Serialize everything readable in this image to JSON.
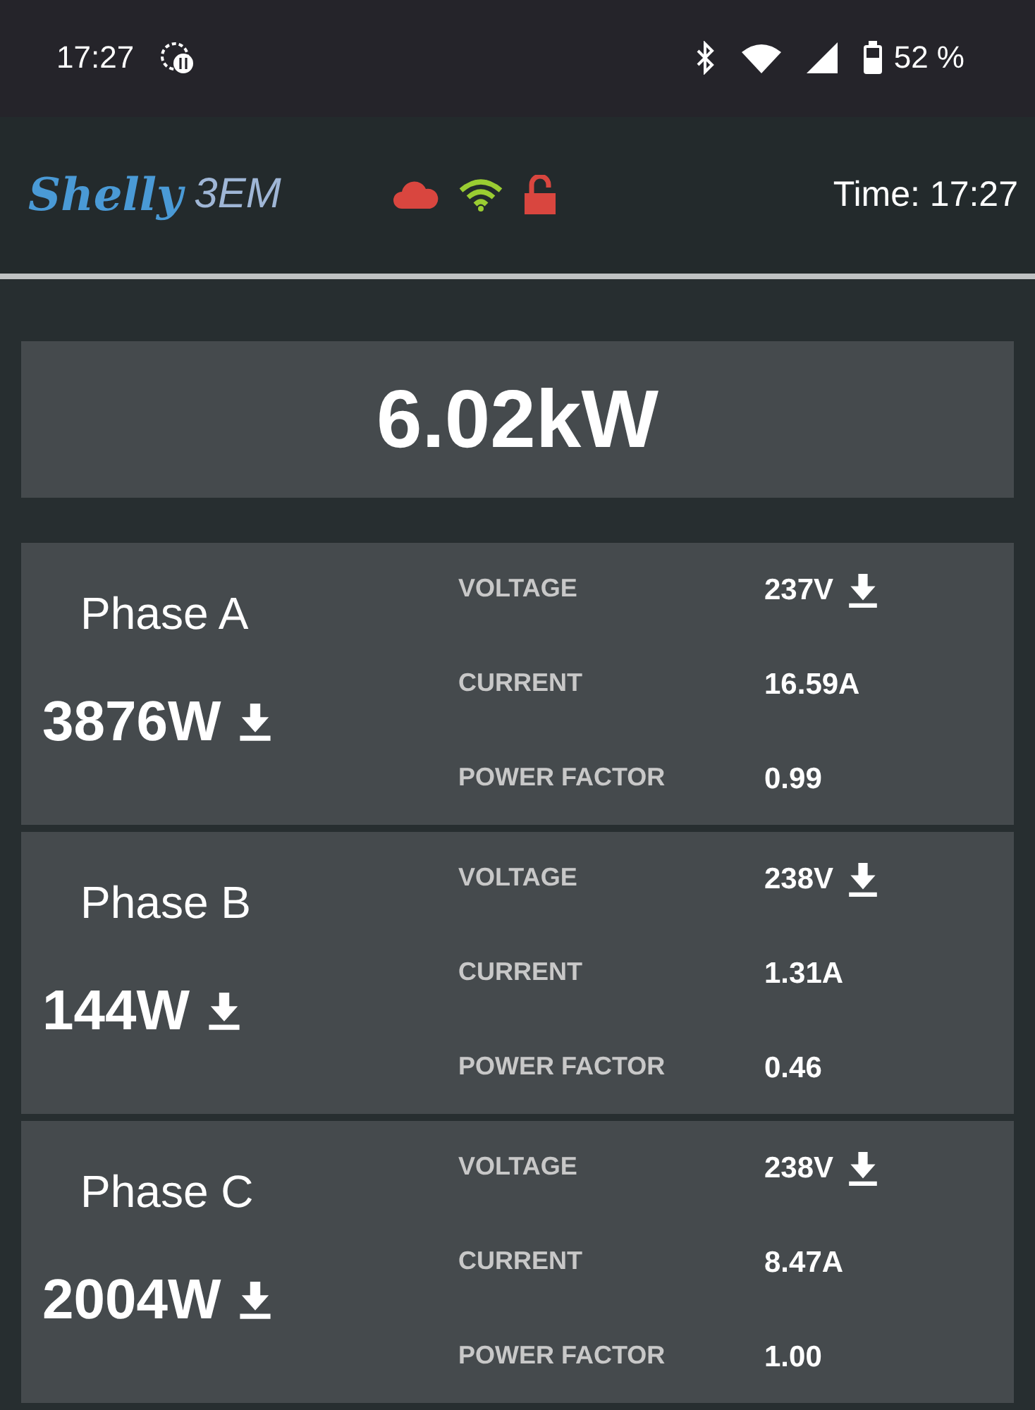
{
  "status_bar": {
    "time": "17:27",
    "battery": "52 %"
  },
  "header": {
    "brand": "Shelly",
    "model": "3EM",
    "time": "Time: 17:27"
  },
  "total_power": "6.02kW",
  "phases": [
    {
      "name": "Phase A",
      "power": "3876W",
      "metrics": [
        {
          "label": "VOLTAGE",
          "value": "237V",
          "arrow": true
        },
        {
          "label": "CURRENT",
          "value": "16.59A",
          "arrow": false
        },
        {
          "label": "POWER FACTOR",
          "value": "0.99",
          "arrow": false
        }
      ]
    },
    {
      "name": "Phase B",
      "power": "144W",
      "metrics": [
        {
          "label": "VOLTAGE",
          "value": "238V",
          "arrow": true
        },
        {
          "label": "CURRENT",
          "value": "1.31A",
          "arrow": false
        },
        {
          "label": "POWER FACTOR",
          "value": "0.46",
          "arrow": false
        }
      ]
    },
    {
      "name": "Phase C",
      "power": "2004W",
      "metrics": [
        {
          "label": "VOLTAGE",
          "value": "238V",
          "arrow": true
        },
        {
          "label": "CURRENT",
          "value": "8.47A",
          "arrow": false
        },
        {
          "label": "POWER FACTOR",
          "value": "1.00",
          "arrow": false
        }
      ]
    }
  ]
}
